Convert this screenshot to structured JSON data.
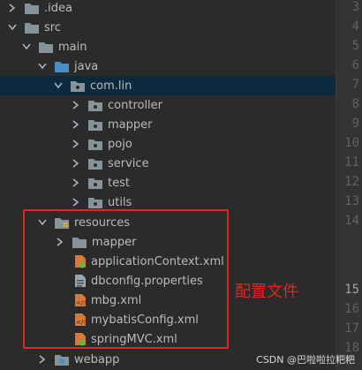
{
  "tree": {
    "idea": ".idea",
    "src": "src",
    "main": "main",
    "java": "java",
    "com_lin": "com.lin",
    "controller": "controller",
    "mapper": "mapper",
    "pojo": "pojo",
    "service": "service",
    "test": "test",
    "utils": "utils",
    "resources": "resources",
    "res_mapper": "mapper",
    "applicationContext": "applicationContext.xml",
    "dbconfig": "dbconfig.properties",
    "mbg": "mbg.xml",
    "mybatisConfig": "mybatisConfig.xml",
    "springMVC": "springMVC.xml",
    "webapp": "webapp"
  },
  "gutter": {
    "lines": [
      "3",
      "4",
      "5",
      "6",
      "7",
      "8",
      "9",
      "10",
      "11",
      "12",
      "13",
      "14",
      "15",
      "16",
      "17",
      "18"
    ],
    "current": "15"
  },
  "annotation": "配置文件",
  "watermark": "CSDN @巴啦啦拉粑粑",
  "colors": {
    "background": "#2b2b2b",
    "selected_row": "#0d293e",
    "folder": "#87939a",
    "source_folder": "#4a90c8",
    "annotation_red": "#e0261f"
  }
}
